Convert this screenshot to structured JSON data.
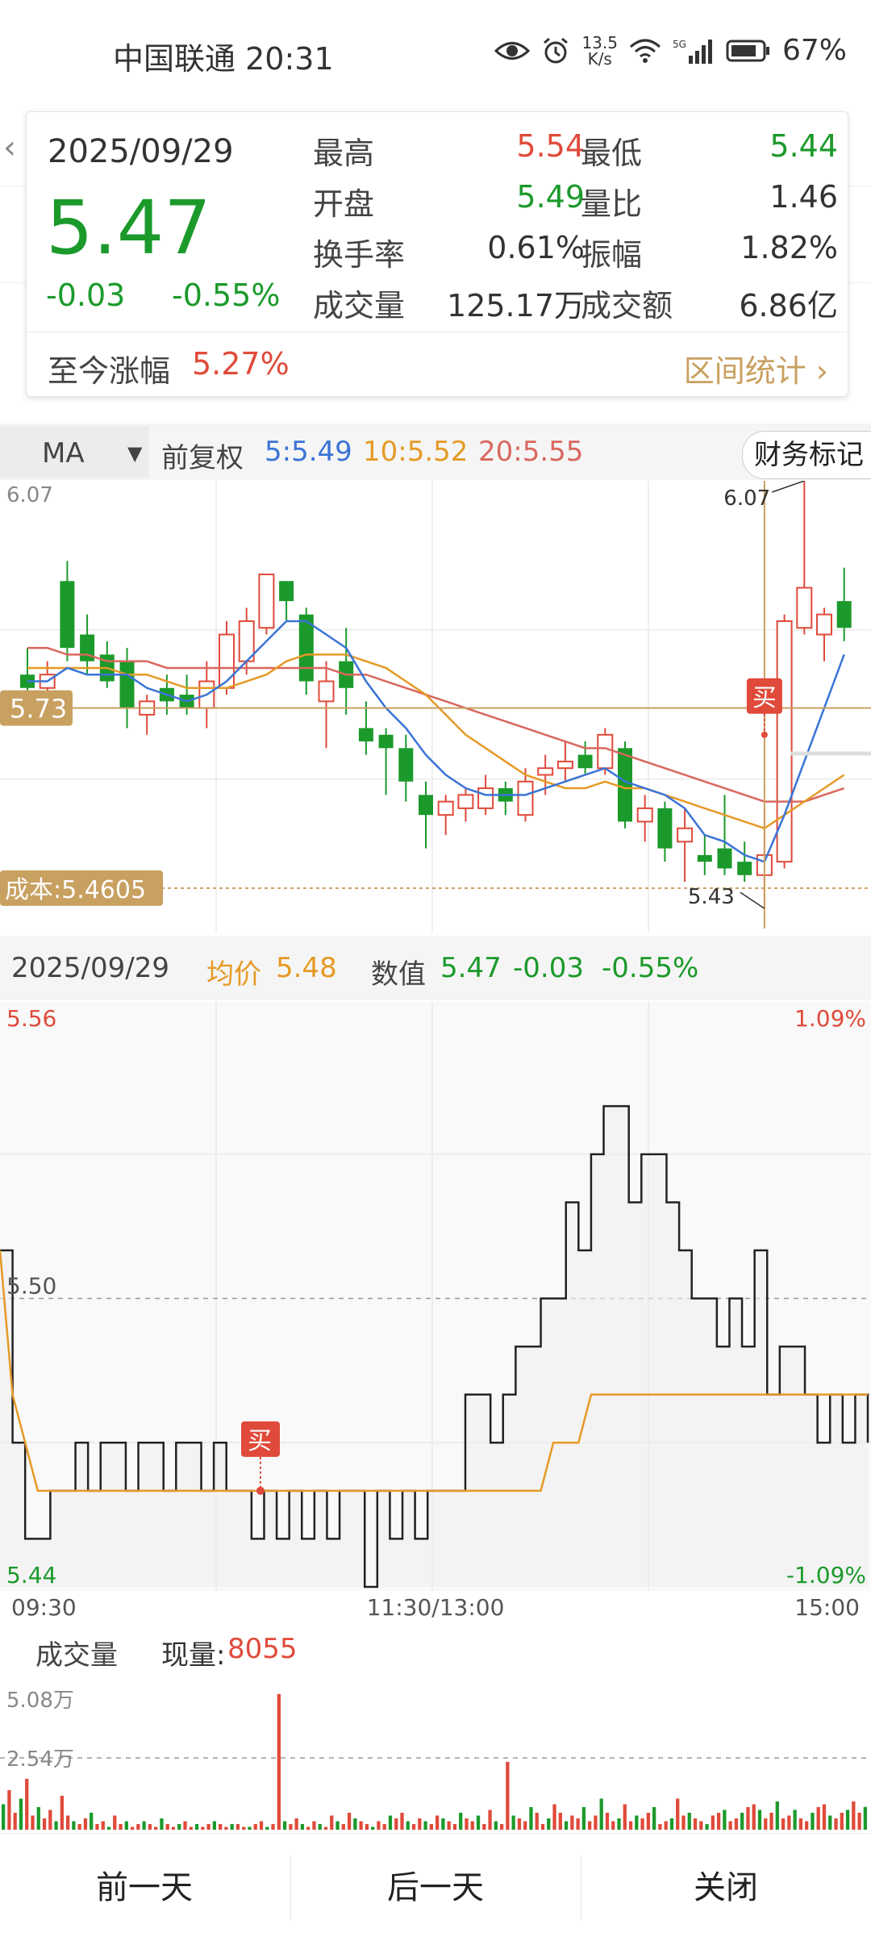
{
  "status_bar": {
    "carrier": "中国联通",
    "time": "20:31",
    "net_speed_value": "13.5",
    "net_speed_unit": "K/s",
    "signal_label": "5G",
    "battery": "67%",
    "icons": [
      "eye-icon",
      "alarm-icon",
      "wifi-icon",
      "signal-icon",
      "battery-icon"
    ]
  },
  "popup": {
    "date": "2025/09/29",
    "price": "5.47",
    "change": "-0.03",
    "change_pct": "-0.55%",
    "rows": [
      {
        "l1": "最高",
        "v1": "5.54",
        "c1": "#e04a3a",
        "l2": "最低",
        "v2": "5.44",
        "c2": "#1b9a2b"
      },
      {
        "l1": "开盘",
        "v1": "5.49",
        "c1": "#1b9a2b",
        "l2": "量比",
        "v2": "1.46",
        "c2": "#333333"
      },
      {
        "l1": "换手率",
        "v1": "0.61%",
        "c1": "#333333",
        "l2": "振幅",
        "v2": "1.82%",
        "c2": "#333333"
      },
      {
        "l1": "成交量",
        "v1": "125.17万",
        "c1": "#333333",
        "l2": "成交额",
        "v2": "6.86亿",
        "c2": "#333333"
      }
    ],
    "since_label": "至今涨幅",
    "since_value": "5.27%",
    "stats_link": "区间统计 ›"
  },
  "ma_bar": {
    "selector": "MA",
    "adjust": "前复权",
    "ma5": "5:5.49",
    "ma10": "10:5.52",
    "ma20": "20:5.55",
    "finance_mark": "财务标记"
  },
  "kline": {
    "top_label": "6.07",
    "cursor_price": "5.73",
    "cost_label": "成本:5.4605",
    "high_mark": "6.07",
    "low_mark": "5.43",
    "buy_tag": "买"
  },
  "intraday": {
    "date": "2025/09/29",
    "avg_label": "均价",
    "avg_value": "5.48",
    "num_label": "数值",
    "num_value": "5.47",
    "num_change": "-0.03",
    "num_change_pct": "-0.55%",
    "y_top": "5.56",
    "y_mid": "5.50",
    "y_bottom": "5.44",
    "pct_top": "1.09%",
    "pct_bottom": "-1.09%",
    "time_start": "09:30",
    "time_mid": "11:30/13:00",
    "time_end": "15:00",
    "buy_tag": "买"
  },
  "volume": {
    "label": "成交量",
    "now_label": "现量:",
    "now_value": "8055",
    "y_top": "5.08万",
    "y_mid": "2.54万"
  },
  "bottom_bar": {
    "prev_day": "前一天",
    "next_day": "后一天",
    "close": "关闭"
  },
  "colors": {
    "up": "#e04a3a",
    "down": "#1b9a2b",
    "ma5": "#3a74d6",
    "ma10": "#e59a26",
    "ma20": "#d9675e",
    "gold": "#c8a060"
  },
  "chart_data": [
    {
      "type": "candlestick",
      "title": "",
      "ylim": [
        5.4,
        6.07
      ],
      "candles": [
        {
          "o": 5.78,
          "h": 5.82,
          "l": 5.74,
          "c": 5.76
        },
        {
          "o": 5.76,
          "h": 5.8,
          "l": 5.73,
          "c": 5.78
        },
        {
          "o": 5.92,
          "h": 5.95,
          "l": 5.8,
          "c": 5.82
        },
        {
          "o": 5.84,
          "h": 5.87,
          "l": 5.78,
          "c": 5.8
        },
        {
          "o": 5.81,
          "h": 5.83,
          "l": 5.76,
          "c": 5.77
        },
        {
          "o": 5.8,
          "h": 5.82,
          "l": 5.7,
          "c": 5.73
        },
        {
          "o": 5.72,
          "h": 5.75,
          "l": 5.69,
          "c": 5.74
        },
        {
          "o": 5.76,
          "h": 5.78,
          "l": 5.72,
          "c": 5.74
        },
        {
          "o": 5.75,
          "h": 5.78,
          "l": 5.72,
          "c": 5.73
        },
        {
          "o": 5.73,
          "h": 5.8,
          "l": 5.7,
          "c": 5.77
        },
        {
          "o": 5.76,
          "h": 5.86,
          "l": 5.75,
          "c": 5.84
        },
        {
          "o": 5.8,
          "h": 5.88,
          "l": 5.78,
          "c": 5.86
        },
        {
          "o": 5.85,
          "h": 5.93,
          "l": 5.84,
          "c": 5.93
        },
        {
          "o": 5.92,
          "h": 5.92,
          "l": 5.86,
          "c": 5.89
        },
        {
          "o": 5.87,
          "h": 5.88,
          "l": 5.75,
          "c": 5.77
        },
        {
          "o": 5.74,
          "h": 5.8,
          "l": 5.67,
          "c": 5.77
        },
        {
          "o": 5.8,
          "h": 5.85,
          "l": 5.72,
          "c": 5.76
        },
        {
          "o": 5.7,
          "h": 5.74,
          "l": 5.66,
          "c": 5.68
        },
        {
          "o": 5.69,
          "h": 5.7,
          "l": 5.6,
          "c": 5.67
        },
        {
          "o": 5.67,
          "h": 5.69,
          "l": 5.59,
          "c": 5.62
        },
        {
          "o": 5.6,
          "h": 5.62,
          "l": 5.52,
          "c": 5.57
        },
        {
          "o": 5.57,
          "h": 5.6,
          "l": 5.54,
          "c": 5.59
        },
        {
          "o": 5.58,
          "h": 5.61,
          "l": 5.56,
          "c": 5.6
        },
        {
          "o": 5.58,
          "h": 5.63,
          "l": 5.57,
          "c": 5.61
        },
        {
          "o": 5.61,
          "h": 5.62,
          "l": 5.57,
          "c": 5.59
        },
        {
          "o": 5.57,
          "h": 5.64,
          "l": 5.56,
          "c": 5.62
        },
        {
          "o": 5.63,
          "h": 5.66,
          "l": 5.6,
          "c": 5.64
        },
        {
          "o": 5.64,
          "h": 5.68,
          "l": 5.62,
          "c": 5.65
        },
        {
          "o": 5.66,
          "h": 5.68,
          "l": 5.63,
          "c": 5.64
        },
        {
          "o": 5.64,
          "h": 5.7,
          "l": 5.63,
          "c": 5.69
        },
        {
          "o": 5.67,
          "h": 5.68,
          "l": 5.55,
          "c": 5.56
        },
        {
          "o": 5.56,
          "h": 5.6,
          "l": 5.53,
          "c": 5.58
        },
        {
          "o": 5.58,
          "h": 5.59,
          "l": 5.5,
          "c": 5.52
        },
        {
          "o": 5.53,
          "h": 5.58,
          "l": 5.47,
          "c": 5.55
        },
        {
          "o": 5.51,
          "h": 5.54,
          "l": 5.48,
          "c": 5.5
        },
        {
          "o": 5.52,
          "h": 5.6,
          "l": 5.48,
          "c": 5.49
        },
        {
          "o": 5.5,
          "h": 5.53,
          "l": 5.47,
          "c": 5.48
        },
        {
          "o": 5.48,
          "h": 5.58,
          "l": 5.43,
          "c": 5.51
        },
        {
          "o": 5.5,
          "h": 5.87,
          "l": 5.49,
          "c": 5.86
        },
        {
          "o": 5.85,
          "h": 6.07,
          "l": 5.84,
          "c": 5.91
        },
        {
          "o": 5.84,
          "h": 5.88,
          "l": 5.8,
          "c": 5.87
        },
        {
          "o": 5.89,
          "h": 5.94,
          "l": 5.83,
          "c": 5.85
        }
      ],
      "ma5": [
        5.77,
        5.77,
        5.79,
        5.78,
        5.78,
        5.78,
        5.76,
        5.75,
        5.74,
        5.75,
        5.77,
        5.8,
        5.83,
        5.86,
        5.86,
        5.84,
        5.82,
        5.77,
        5.73,
        5.7,
        5.66,
        5.63,
        5.61,
        5.6,
        5.6,
        5.6,
        5.61,
        5.62,
        5.63,
        5.64,
        5.62,
        5.61,
        5.6,
        5.58,
        5.54,
        5.53,
        5.51,
        5.5,
        5.57,
        5.65,
        5.73,
        5.81
      ],
      "ma10": [
        5.79,
        5.79,
        5.79,
        5.79,
        5.79,
        5.78,
        5.78,
        5.77,
        5.76,
        5.76,
        5.76,
        5.77,
        5.78,
        5.8,
        5.81,
        5.81,
        5.81,
        5.8,
        5.79,
        5.77,
        5.75,
        5.72,
        5.69,
        5.67,
        5.65,
        5.63,
        5.62,
        5.61,
        5.61,
        5.62,
        5.61,
        5.61,
        5.6,
        5.59,
        5.58,
        5.57,
        5.56,
        5.55,
        5.57,
        5.59,
        5.61,
        5.63
      ],
      "ma20": [
        5.82,
        5.82,
        5.81,
        5.81,
        5.8,
        5.8,
        5.8,
        5.79,
        5.79,
        5.79,
        5.79,
        5.79,
        5.79,
        5.79,
        5.79,
        5.79,
        5.78,
        5.78,
        5.77,
        5.76,
        5.75,
        5.74,
        5.73,
        5.72,
        5.71,
        5.7,
        5.69,
        5.68,
        5.67,
        5.67,
        5.66,
        5.65,
        5.64,
        5.63,
        5.62,
        5.61,
        5.6,
        5.59,
        5.59,
        5.59,
        5.6,
        5.61
      ],
      "cursor_price": 5.73,
      "cost_line": 5.4605,
      "high": 6.07,
      "low": 5.43
    },
    {
      "type": "line",
      "title": "",
      "ylim": [
        5.44,
        5.56
      ],
      "x": [
        "09:30",
        "11:30/13:00",
        "15:00"
      ],
      "series": [
        {
          "name": "数值",
          "values": [
            5.51,
            5.47,
            5.45,
            5.45,
            5.46,
            5.46,
            5.47,
            5.46,
            5.47,
            5.47,
            5.46,
            5.47,
            5.47,
            5.46,
            5.47,
            5.47,
            5.46,
            5.47,
            5.46,
            5.46,
            5.45,
            5.46,
            5.45,
            5.46,
            5.45,
            5.46,
            5.45,
            5.46,
            5.46,
            5.44,
            5.46,
            5.45,
            5.46,
            5.45,
            5.46,
            5.46,
            5.46,
            5.48,
            5.48,
            5.47,
            5.48,
            5.49,
            5.49,
            5.5,
            5.5,
            5.52,
            5.51,
            5.53,
            5.54,
            5.54,
            5.52,
            5.53,
            5.53,
            5.52,
            5.51,
            5.5,
            5.5,
            5.49,
            5.5,
            5.49,
            5.51,
            5.48,
            5.49,
            5.49,
            5.48,
            5.47,
            5.48,
            5.47,
            5.48,
            5.47
          ]
        },
        {
          "name": "均价",
          "values": [
            5.51,
            5.48,
            5.47,
            5.46,
            5.46,
            5.46,
            5.46,
            5.46,
            5.46,
            5.46,
            5.46,
            5.46,
            5.46,
            5.46,
            5.46,
            5.46,
            5.46,
            5.46,
            5.46,
            5.46,
            5.46,
            5.46,
            5.46,
            5.46,
            5.46,
            5.46,
            5.46,
            5.46,
            5.46,
            5.46,
            5.46,
            5.46,
            5.46,
            5.46,
            5.46,
            5.46,
            5.46,
            5.46,
            5.46,
            5.46,
            5.46,
            5.46,
            5.46,
            5.46,
            5.47,
            5.47,
            5.47,
            5.48,
            5.48,
            5.48,
            5.48,
            5.48,
            5.48,
            5.48,
            5.48,
            5.48,
            5.48,
            5.48,
            5.48,
            5.48,
            5.48,
            5.48,
            5.48,
            5.48,
            5.48,
            5.48,
            5.48,
            5.48,
            5.48,
            5.48
          ]
        }
      ]
    },
    {
      "type": "bar",
      "title": "",
      "ylim": [
        0,
        50800
      ],
      "values": [
        9000,
        14000,
        6000,
        11000,
        18000,
        5000,
        8000,
        4000,
        7000,
        3000,
        12000,
        5000,
        3000,
        2000,
        4000,
        6000,
        2000,
        3000,
        1000,
        5000,
        2000,
        3000,
        1000,
        2000,
        3000,
        2000,
        1000,
        4000,
        2000,
        1000,
        2000,
        3000,
        1000,
        2000,
        1000,
        2000,
        3000,
        2000,
        1000,
        2000,
        2000,
        1000,
        1000,
        2000,
        3000,
        1000,
        2000,
        48000,
        3000,
        2000,
        4000,
        2000,
        1000,
        3000,
        2000,
        1000,
        5000,
        3000,
        2000,
        6000,
        4000,
        3000,
        2000,
        1000,
        3000,
        2000,
        5000,
        4000,
        6000,
        3000,
        2000,
        4000,
        3000,
        2000,
        5000,
        4000,
        3000,
        2000,
        6000,
        4000,
        3000,
        5000,
        2000,
        7000,
        3000,
        2000,
        24000,
        5000,
        4000,
        3000,
        8000,
        6000,
        2000,
        4000,
        9000,
        6000,
        3000,
        5000,
        4000,
        8000,
        3000,
        5000,
        11000,
        6000,
        3000,
        4000,
        9000,
        3000,
        5000,
        4000,
        6000,
        8000,
        2000,
        3000,
        4000,
        11000,
        5000,
        6000,
        4000,
        3000,
        2000,
        5000,
        6000,
        7000,
        3000,
        4000,
        6000,
        8000,
        9000,
        7000,
        4000,
        6000,
        10000,
        4000,
        5000,
        7000,
        4000,
        3000,
        6000,
        8000,
        9000,
        5000,
        4000,
        6000,
        7000,
        10000,
        6000,
        8055
      ],
      "colors": [
        "up",
        "down"
      ]
    }
  ]
}
